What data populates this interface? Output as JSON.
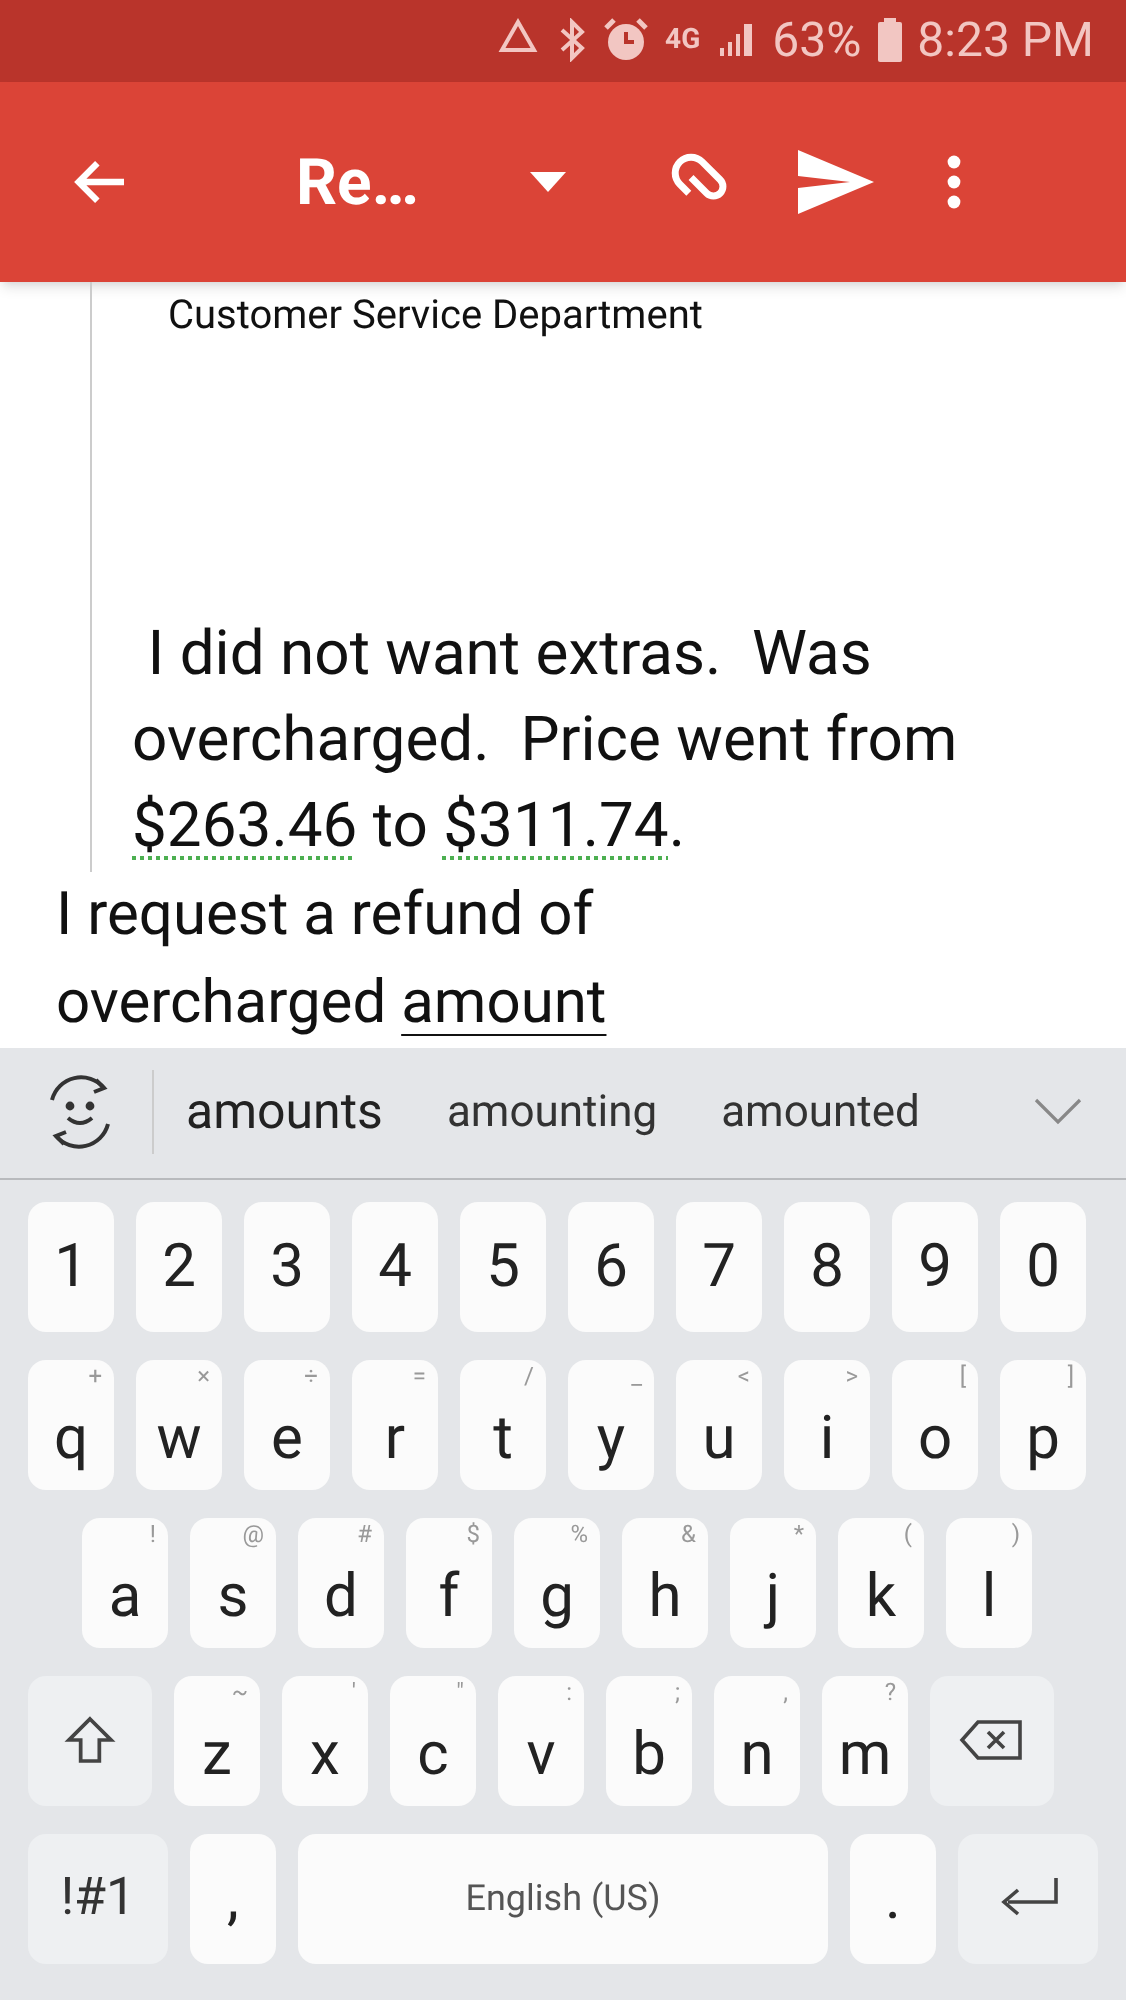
{
  "status_bar": {
    "network": "4G",
    "battery": "63%",
    "time": "8:23 PM"
  },
  "toolbar": {
    "title": "Re…"
  },
  "message": {
    "quoted_line": "Customer Service Department",
    "quoted_paragraph": [
      {
        "text": " I did not want extras.  Was overcharged.  Price went from ",
        "kind": "plain"
      },
      {
        "text": "$263.46",
        "kind": "flagged"
      },
      {
        "text": " to ",
        "kind": "plain"
      },
      {
        "text": "$311.74",
        "kind": "flagged"
      },
      {
        "text": ".",
        "kind": "plain"
      }
    ],
    "reply_paragraph": [
      {
        "text": "I request a refund of overcharged ",
        "kind": "plain"
      },
      {
        "text": "amount",
        "kind": "composing"
      }
    ]
  },
  "suggestions": [
    {
      "text": "amounts",
      "selected": true
    },
    {
      "text": "amounting",
      "selected": false
    },
    {
      "text": "amounted",
      "selected": false
    }
  ],
  "keyboard": {
    "rows": [
      [
        {
          "label": "1",
          "kind": "char"
        },
        {
          "label": "2",
          "kind": "char"
        },
        {
          "label": "3",
          "kind": "char"
        },
        {
          "label": "4",
          "kind": "char"
        },
        {
          "label": "5",
          "kind": "char"
        },
        {
          "label": "6",
          "kind": "char"
        },
        {
          "label": "7",
          "kind": "char"
        },
        {
          "label": "8",
          "kind": "char"
        },
        {
          "label": "9",
          "kind": "char"
        },
        {
          "label": "0",
          "kind": "char"
        }
      ],
      [
        {
          "label": "q",
          "hint": "+",
          "kind": "char"
        },
        {
          "label": "w",
          "hint": "×",
          "kind": "char"
        },
        {
          "label": "e",
          "hint": "÷",
          "kind": "char"
        },
        {
          "label": "r",
          "hint": "=",
          "kind": "char"
        },
        {
          "label": "t",
          "hint": "/",
          "kind": "char"
        },
        {
          "label": "y",
          "hint": "_",
          "kind": "char"
        },
        {
          "label": "u",
          "hint": "<",
          "kind": "char"
        },
        {
          "label": "i",
          "hint": ">",
          "kind": "char"
        },
        {
          "label": "o",
          "hint": "[",
          "kind": "char"
        },
        {
          "label": "p",
          "hint": "]",
          "kind": "char"
        }
      ],
      [
        {
          "label": "a",
          "hint": "!",
          "kind": "char"
        },
        {
          "label": "s",
          "hint": "@",
          "kind": "char"
        },
        {
          "label": "d",
          "hint": "#",
          "kind": "char"
        },
        {
          "label": "f",
          "hint": "$",
          "kind": "char"
        },
        {
          "label": "g",
          "hint": "%",
          "kind": "char"
        },
        {
          "label": "h",
          "hint": "&",
          "kind": "char"
        },
        {
          "label": "j",
          "hint": "*",
          "kind": "char"
        },
        {
          "label": "k",
          "hint": "(",
          "kind": "char"
        },
        {
          "label": "l",
          "hint": ")",
          "kind": "char"
        }
      ],
      [
        {
          "kind": "shift"
        },
        {
          "label": "z",
          "hint": "~",
          "kind": "char"
        },
        {
          "label": "x",
          "hint": "'",
          "kind": "char"
        },
        {
          "label": "c",
          "hint": "\"",
          "kind": "char"
        },
        {
          "label": "v",
          "hint": ":",
          "kind": "char"
        },
        {
          "label": "b",
          "hint": ";",
          "kind": "char"
        },
        {
          "label": "n",
          "hint": ",",
          "kind": "char"
        },
        {
          "label": "m",
          "hint": "?",
          "kind": "char"
        },
        {
          "kind": "backspace"
        }
      ],
      {
        "symbols": "!#1",
        "comma": ",",
        "space": "English (US)",
        "period": "."
      }
    ]
  }
}
